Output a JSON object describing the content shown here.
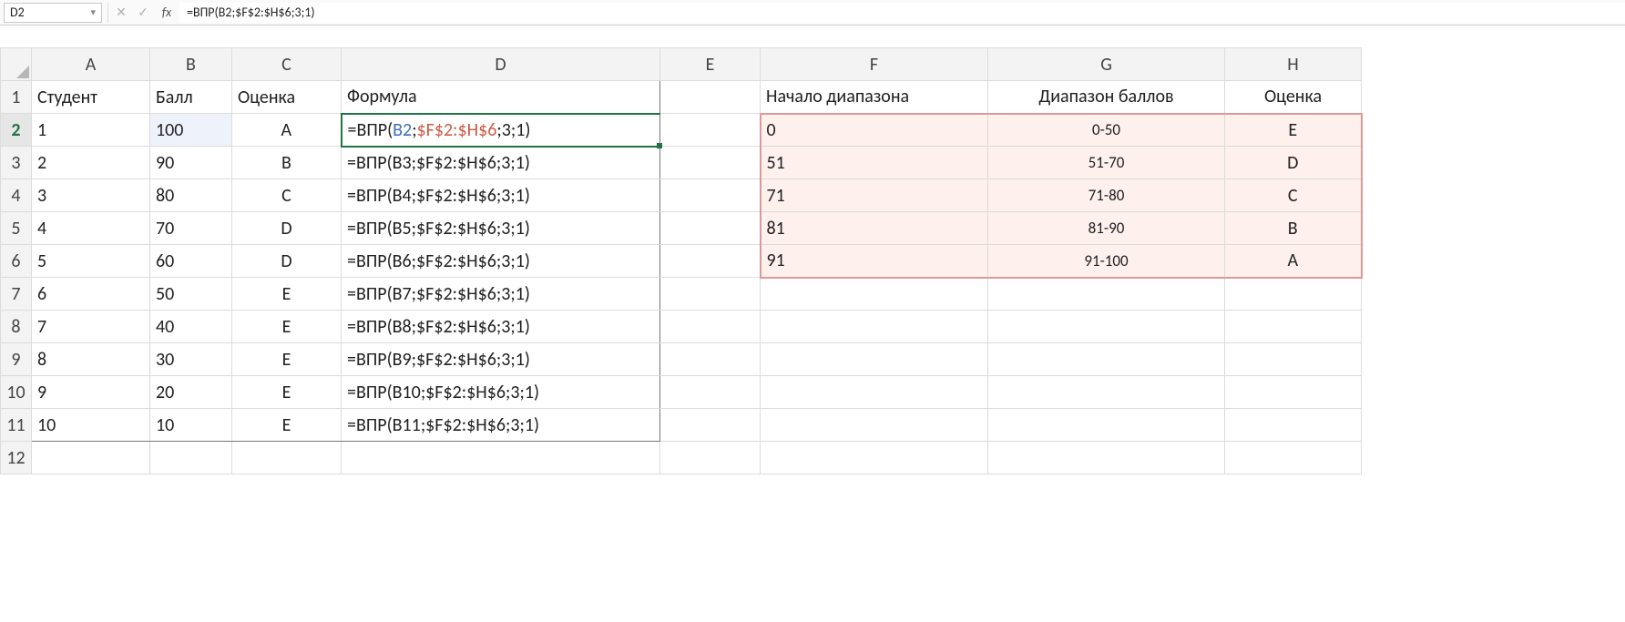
{
  "namebox": "D2",
  "formula_bar": {
    "prefix": "=ВПР(",
    "arg1": "B2",
    "sep1": ";",
    "arg2": "$F$2:$H$6",
    "sep2": ";3;1)"
  },
  "columns": [
    "A",
    "B",
    "C",
    "D",
    "E",
    "F",
    "G",
    "H"
  ],
  "headers": {
    "A": "Студент",
    "B": "Балл",
    "C": "Оценка",
    "D": "Формула",
    "F": "Начало диапазона",
    "G": "Диапазон баллов",
    "H": "Оценка"
  },
  "students": [
    {
      "n": "1",
      "score": "100",
      "grade": "A",
      "formula": "=ВПР(B2;$F$2:$H$6;3;1)"
    },
    {
      "n": "2",
      "score": "90",
      "grade": "B",
      "formula": "=ВПР(B3;$F$2:$H$6;3;1)"
    },
    {
      "n": "3",
      "score": "80",
      "grade": "C",
      "formula": "=ВПР(B4;$F$2:$H$6;3;1)"
    },
    {
      "n": "4",
      "score": "70",
      "grade": "D",
      "formula": "=ВПР(B5;$F$2:$H$6;3;1)"
    },
    {
      "n": "5",
      "score": "60",
      "grade": "D",
      "formula": "=ВПР(B6;$F$2:$H$6;3;1)"
    },
    {
      "n": "6",
      "score": "50",
      "grade": "E",
      "formula": "=ВПР(B7;$F$2:$H$6;3;1)"
    },
    {
      "n": "7",
      "score": "40",
      "grade": "E",
      "formula": "=ВПР(B8;$F$2:$H$6;3;1)"
    },
    {
      "n": "8",
      "score": "30",
      "grade": "E",
      "formula": "=ВПР(B9;$F$2:$H$6;3;1)"
    },
    {
      "n": "9",
      "score": "20",
      "grade": "E",
      "formula": "=ВПР(B10;$F$2:$H$6;3;1)"
    },
    {
      "n": "10",
      "score": "10",
      "grade": "E",
      "formula": "=ВПР(B11;$F$2:$H$6;3;1)"
    }
  ],
  "lookup": [
    {
      "start": "0",
      "range": "0-50",
      "grade": "E"
    },
    {
      "start": "51",
      "range": "51-70",
      "grade": "D"
    },
    {
      "start": "71",
      "range": "71-80",
      "grade": "C"
    },
    {
      "start": "81",
      "range": "81-90",
      "grade": "B"
    },
    {
      "start": "91",
      "range": "91-100",
      "grade": "A"
    }
  ],
  "active_formula": {
    "prefix": "=ВПР(",
    "arg1": "B2",
    "sep1": ";",
    "arg2": "$F$2:$H$6",
    "sep2": ";3;1)"
  }
}
